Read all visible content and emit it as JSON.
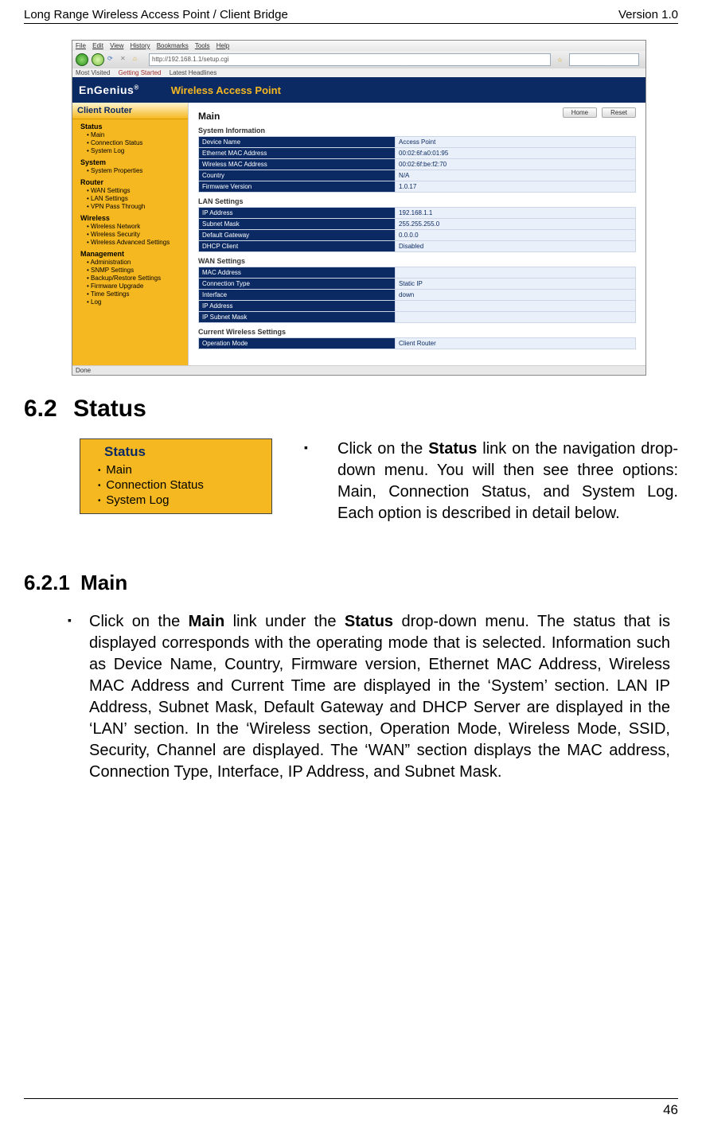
{
  "header": {
    "left": "Long Range Wireless Access Point / Client Bridge",
    "right": "Version 1.0"
  },
  "browser": {
    "menu": [
      "File",
      "Edit",
      "View",
      "History",
      "Bookmarks",
      "Tools",
      "Help"
    ],
    "url": "http://192.168.1.1/setup.cgi",
    "bookmarks": [
      "Most Visited",
      "Getting Started",
      "Latest Headlines"
    ],
    "status": "Done"
  },
  "app": {
    "brand": "EnGenius",
    "brand_tag": "Wireless Access Point",
    "sidebar_title": "Client Router",
    "nav": {
      "status_label": "Status",
      "status_items": [
        "Main",
        "Connection Status",
        "System Log"
      ],
      "system_label": "System",
      "system_items": [
        "System Properties"
      ],
      "router_label": "Router",
      "router_items": [
        "WAN Settings",
        "LAN Settings",
        "VPN Pass Through"
      ],
      "wireless_label": "Wireless",
      "wireless_items": [
        "Wireless Network",
        "Wireless Security",
        "Wireless Advanced Settings"
      ],
      "mgmt_label": "Management",
      "mgmt_items": [
        "Administration",
        "SNMP Settings",
        "Backup/Restore Settings",
        "Firmware Upgrade",
        "Time Settings",
        "Log"
      ]
    },
    "main_title": "Main",
    "buttons": {
      "home": "Home",
      "reset": "Reset"
    },
    "sections": {
      "sysinfo": {
        "title": "System Information",
        "rows": [
          [
            "Device Name",
            "Access Point"
          ],
          [
            "Ethernet MAC Address",
            "00:02:6f:a0:01:95"
          ],
          [
            "Wireless MAC Address",
            "00:02:6f:be:f2:70"
          ],
          [
            "Country",
            "N/A"
          ],
          [
            "Firmware Version",
            "1.0.17"
          ]
        ]
      },
      "lan": {
        "title": "LAN Settings",
        "rows": [
          [
            "IP Address",
            "192.168.1.1"
          ],
          [
            "Subnet Mask",
            "255.255.255.0"
          ],
          [
            "Default Gateway",
            "0.0.0.0"
          ],
          [
            "DHCP Client",
            "Disabled"
          ]
        ]
      },
      "wan": {
        "title": "WAN Settings",
        "rows": [
          [
            "MAC Address",
            ""
          ],
          [
            "Connection Type",
            "Static IP"
          ],
          [
            "Interface",
            "down"
          ],
          [
            "IP Address",
            ""
          ],
          [
            "IP Subnet Mask",
            ""
          ]
        ]
      },
      "wireless": {
        "title": "Current Wireless Settings",
        "rows": [
          [
            "Operation Mode",
            "Client Router"
          ]
        ]
      }
    }
  },
  "section62": {
    "num": "6.2",
    "title": "Status",
    "status_panel": {
      "heading": "Status",
      "items": [
        "Main",
        "Connection Status",
        "System Log"
      ]
    },
    "bullet_prefix": "Click on the ",
    "bullet_bold": "Status",
    "bullet_rest": " link on the navigation drop-down menu. You will then see three options: Main, Connection Status, and System Log. Each option is described in detail below."
  },
  "section621": {
    "num": "6.2.1",
    "title": "Main",
    "bullet_prefix": "Click on the ",
    "bullet_bold1": "Main",
    "bullet_mid": " link under the ",
    "bullet_bold2": "Status",
    "bullet_rest": " drop-down menu. The status that is displayed corresponds with the operating mode that is selected. Information such as Device Name, Country, Firmware version, Ethernet MAC Address, Wireless MAC Address and Current Time are displayed in the ‘System’ section. LAN IP Address, Subnet Mask, Default Gateway and DHCP Server are displayed in the ‘LAN’ section. In the ‘Wireless section, Operation Mode, Wireless Mode, SSID, Security, Channel are displayed. The ‘WAN” section displays the MAC address, Connection Type, Interface, IP Address, and Subnet Mask."
  },
  "footer": {
    "page": "46"
  }
}
